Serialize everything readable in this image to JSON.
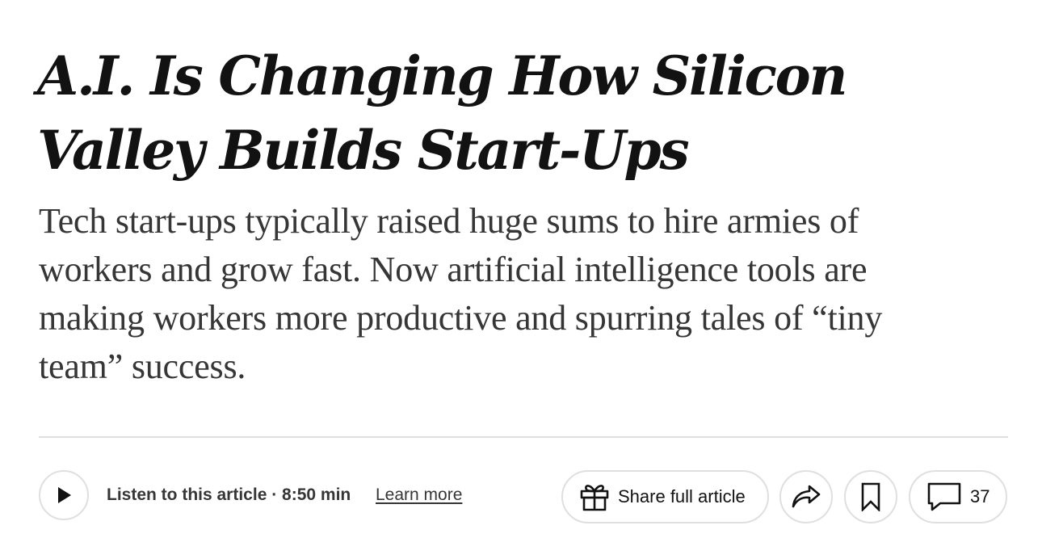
{
  "article": {
    "headline": "A.I. Is Changing How Silicon Valley Builds Start-Ups",
    "summary": "Tech start-ups typically raised huge sums to hire armies of workers and grow fast. Now artificial intelligence tools are making workers more productive and spurring tales of “tiny team” success."
  },
  "audio": {
    "icon": "play-icon",
    "listen_label": "Listen to this article · 8:50 min",
    "learn_more_label": "Learn more"
  },
  "actions": {
    "share_icon": "gift-icon",
    "share_label": "Share full article",
    "forward_icon": "share-arrow-icon",
    "save_icon": "bookmark-icon",
    "comments_icon": "comment-icon",
    "comment_count": "37"
  },
  "colors": {
    "headline": "#121212",
    "body_text": "#363636",
    "border": "#dfdfdf",
    "background": "#ffffff"
  }
}
